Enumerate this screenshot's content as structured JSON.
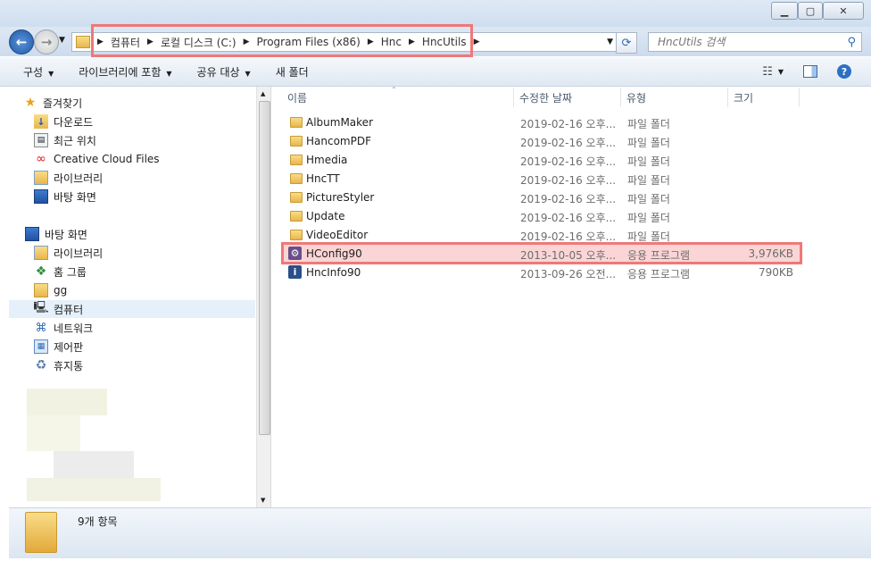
{
  "address_bar": {
    "breadcrumbs": [
      "컴퓨터",
      "로컬 디스크 (C:)",
      "Program Files (x86)",
      "Hnc",
      "HncUtils"
    ]
  },
  "search": {
    "placeholder": "HncUtils 검색"
  },
  "toolbar": {
    "organize": "구성",
    "include_in_library": "라이브러리에 포함",
    "share_with": "공유 대상",
    "new_folder": "새 폴더"
  },
  "sidebar": {
    "favorites_label": "즐겨찾기",
    "favorites": [
      "다운로드",
      "최근 위치",
      "Creative Cloud Files",
      "라이브러리",
      "바탕 화면"
    ],
    "desktop_label": "바탕 화면",
    "desktop_items": [
      "라이브러리",
      "홈 그룹",
      "gg",
      "컴퓨터",
      "네트워크",
      "제어판",
      "휴지통"
    ]
  },
  "columns": {
    "name": "이름",
    "modified": "수정한 날짜",
    "type": "유형",
    "size": "크기"
  },
  "files": [
    {
      "name": "AlbumMaker",
      "modified": "2019-02-16 오후...",
      "type": "파일 폴더",
      "size": "",
      "icon": "folder-icon"
    },
    {
      "name": "HancomPDF",
      "modified": "2019-02-16 오후...",
      "type": "파일 폴더",
      "size": "",
      "icon": "folder-icon"
    },
    {
      "name": "Hmedia",
      "modified": "2019-02-16 오후...",
      "type": "파일 폴더",
      "size": "",
      "icon": "folder-icon"
    },
    {
      "name": "HncTT",
      "modified": "2019-02-16 오후...",
      "type": "파일 폴더",
      "size": "",
      "icon": "folder-icon"
    },
    {
      "name": "PictureStyler",
      "modified": "2019-02-16 오후...",
      "type": "파일 폴더",
      "size": "",
      "icon": "folder-icon"
    },
    {
      "name": "Update",
      "modified": "2019-02-16 오후...",
      "type": "파일 폴더",
      "size": "",
      "icon": "folder-icon"
    },
    {
      "name": "VideoEditor",
      "modified": "2019-02-16 오후...",
      "type": "파일 폴더",
      "size": "",
      "icon": "folder-icon"
    },
    {
      "name": "HConfig90",
      "modified": "2013-10-05 오후...",
      "type": "응용 프로그램",
      "size": "3,976KB",
      "icon": "gear-app-icon"
    },
    {
      "name": "HncInfo90",
      "modified": "2013-09-26 오전...",
      "type": "응용 프로그램",
      "size": "790KB",
      "icon": "info-app-icon"
    }
  ],
  "status": {
    "item_count": "9개 항목"
  },
  "colors": {
    "highlight": "#f08080",
    "selected_nav": "#e5f0fb"
  }
}
